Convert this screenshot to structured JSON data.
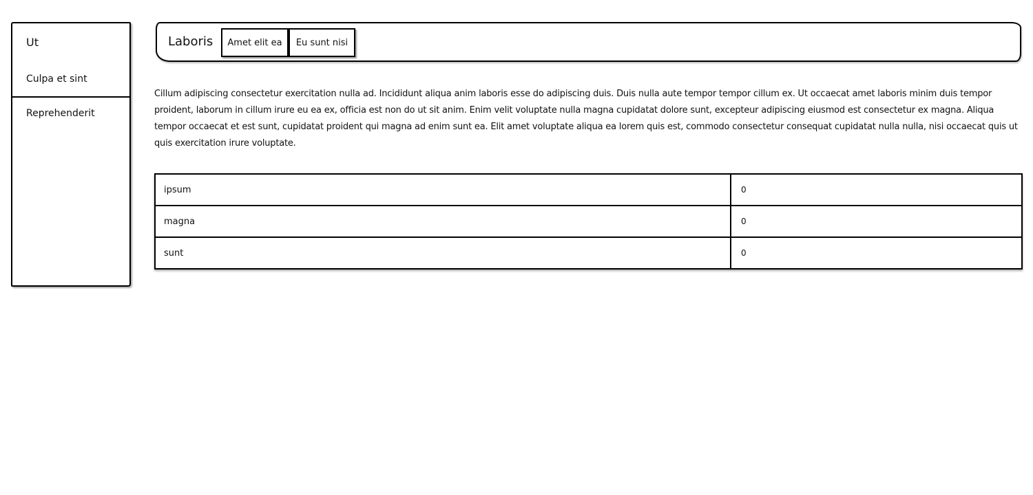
{
  "sidebar": {
    "header": "Ut",
    "items": [
      {
        "label": "Culpa et sint"
      },
      {
        "label": "Reprehenderit"
      }
    ]
  },
  "navbar": {
    "brand": "Laboris",
    "buttons": [
      {
        "label": "Amet elit ea"
      },
      {
        "label": "Eu sunt nisi"
      }
    ]
  },
  "content": {
    "paragraph": "Cillum adipiscing consectetur exercitation nulla ad. Incididunt aliqua anim laboris esse do adipiscing duis. Duis nulla aute tempor tempor cillum ex. Ut occaecat amet laboris minim duis tempor proident, laborum in cillum irure eu ea ex, officia est non do ut sit anim. Enim velit voluptate nulla magna cupidatat dolore sunt, excepteur adipiscing eiusmod est consectetur ex magna. Aliqua tempor occaecat et est sunt, cupidatat proident qui magna ad enim sunt ea. Elit amet voluptate aliqua ea lorem quis est, commodo consectetur consequat cupidatat nulla nulla, nisi occaecat quis ut quis exercitation irure voluptate."
  },
  "table": {
    "rows": [
      {
        "name": "ipsum",
        "value": "0"
      },
      {
        "name": "magna",
        "value": "0"
      },
      {
        "name": "sunt",
        "value": "0"
      }
    ]
  }
}
